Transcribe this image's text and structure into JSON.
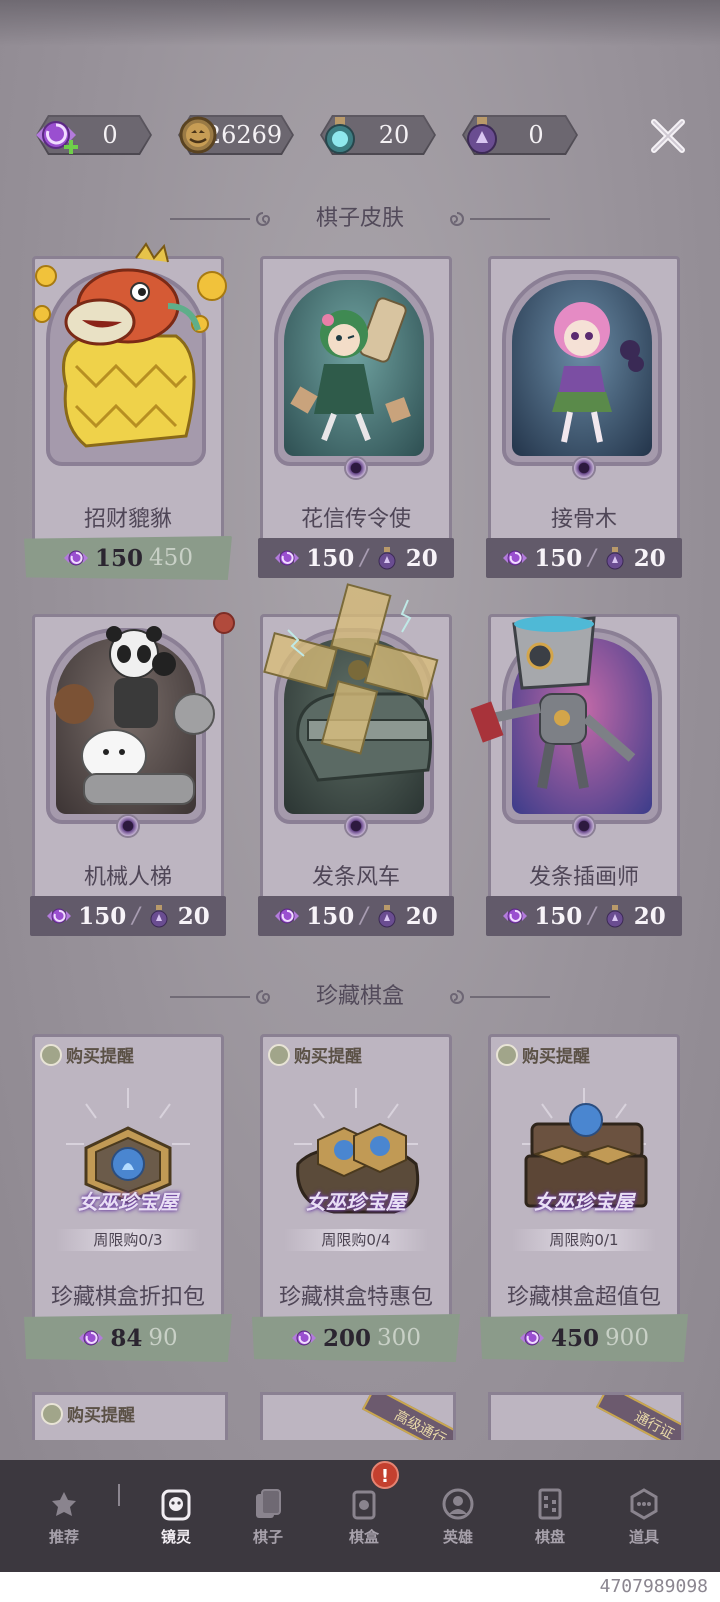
{
  "currencies": [
    {
      "name": "candy-plus",
      "value": "0"
    },
    {
      "name": "pumpkin-coin",
      "value": "26269"
    },
    {
      "name": "spirit-bottle",
      "value": "20"
    },
    {
      "name": "crystal-bottle",
      "value": "0"
    }
  ],
  "sections": {
    "skins_title": "棋子皮肤",
    "boxes_title": "珍藏棋盒"
  },
  "skins": [
    {
      "name": "招财貔貅",
      "price": "150",
      "original": "450",
      "style": "green"
    },
    {
      "name": "花信传令使",
      "price_candy": "150",
      "price_bottle": "20"
    },
    {
      "name": "接骨木",
      "price_candy": "150",
      "price_bottle": "20"
    },
    {
      "name": "机械人梯",
      "price_candy": "150",
      "price_bottle": "20"
    },
    {
      "name": "发条风车",
      "price_candy": "150",
      "price_bottle": "20"
    },
    {
      "name": "发条插画师",
      "price_candy": "150",
      "price_bottle": "20"
    }
  ],
  "boxes": [
    {
      "remind": "购买提醒",
      "logo": "女巫珍宝屋",
      "limit": "周限购0/3",
      "name": "珍藏棋盒折扣包",
      "price": "84",
      "original": "90"
    },
    {
      "remind": "购买提醒",
      "logo": "女巫珍宝屋",
      "limit": "周限购0/4",
      "name": "珍藏棋盒特惠包",
      "price": "200",
      "original": "300"
    },
    {
      "remind": "购买提醒",
      "logo": "女巫珍宝屋",
      "limit": "周限购0/1",
      "name": "珍藏棋盒超值包",
      "price": "450",
      "original": "900"
    }
  ],
  "partial_row": {
    "remind": "购买提醒",
    "ribbon_1": "高级通行",
    "ribbon_2": "通行证"
  },
  "nav": [
    {
      "label": "推荐",
      "active": false
    },
    {
      "label": "镜灵",
      "active": true
    },
    {
      "label": "棋子",
      "active": false
    },
    {
      "label": "棋盒",
      "active": false,
      "badge": "!"
    },
    {
      "label": "英雄",
      "active": false
    },
    {
      "label": "棋盘",
      "active": false
    },
    {
      "label": "道具",
      "active": false
    }
  ],
  "footer_id": "4707989098"
}
